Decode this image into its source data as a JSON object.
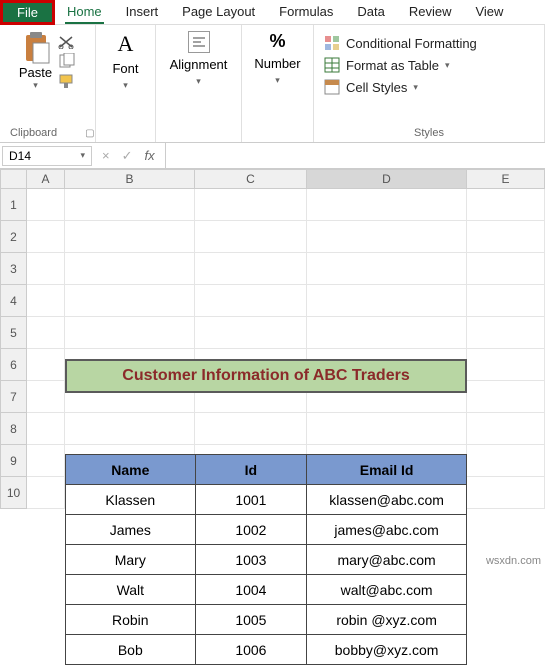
{
  "tabs": {
    "file": "File",
    "home": "Home",
    "insert": "Insert",
    "page_layout": "Page Layout",
    "formulas": "Formulas",
    "data": "Data",
    "review": "Review",
    "view": "View"
  },
  "ribbon": {
    "clipboard": {
      "paste": "Paste",
      "title": "Clipboard"
    },
    "font": {
      "label": "Font"
    },
    "alignment": {
      "label": "Alignment"
    },
    "number": {
      "label": "Number"
    },
    "styles": {
      "cond": "Conditional Formatting",
      "table": "Format as Table",
      "cell": "Cell Styles",
      "title": "Styles"
    }
  },
  "namebox": {
    "value": "D14"
  },
  "fx": {
    "times": "×",
    "check": "✓",
    "label": "fx"
  },
  "columns": {
    "A": "A",
    "B": "B",
    "C": "C",
    "D": "D",
    "E": "E"
  },
  "rownums": [
    "1",
    "2",
    "3",
    "4",
    "5",
    "6",
    "7",
    "8",
    "9",
    "10"
  ],
  "banner": "Customer Information of ABC Traders",
  "table": {
    "h1": "Name",
    "h2": "Id",
    "h3": "Email Id",
    "rows": [
      {
        "n": "Klassen",
        "i": "1001",
        "e": "klassen@abc.com"
      },
      {
        "n": "James",
        "i": "1002",
        "e": "james@abc.com"
      },
      {
        "n": "Mary",
        "i": "1003",
        "e": "mary@abc.com"
      },
      {
        "n": "Walt",
        "i": "1004",
        "e": "walt@abc.com"
      },
      {
        "n": "Robin",
        "i": "1005",
        "e": "robin @xyz.com"
      },
      {
        "n": "Bob",
        "i": "1006",
        "e": "bobby@xyz.com"
      }
    ]
  },
  "watermark": "wsxdn.com",
  "chart_data": {
    "type": "table",
    "title": "Customer Information of ABC Traders",
    "columns": [
      "Name",
      "Id",
      "Email Id"
    ],
    "rows": [
      [
        "Klassen",
        1001,
        "klassen@abc.com"
      ],
      [
        "James",
        1002,
        "james@abc.com"
      ],
      [
        "Mary",
        1003,
        "mary@abc.com"
      ],
      [
        "Walt",
        1004,
        "walt@abc.com"
      ],
      [
        "Robin",
        1005,
        "robin @xyz.com"
      ],
      [
        "Bob",
        1006,
        "bobby@xyz.com"
      ]
    ]
  }
}
